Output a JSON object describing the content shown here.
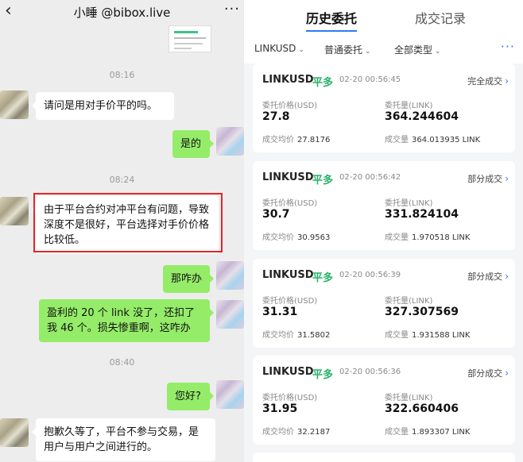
{
  "chat": {
    "back_icon": "back-arrow-icon",
    "title": "小睡 @bibox.live",
    "more_icon": "more-dots-icon",
    "timestamps": [
      "08:16",
      "08:24",
      "08:40"
    ],
    "messages": [
      {
        "side": "in",
        "text": "请问是用对手价平的吗。"
      },
      {
        "side": "out",
        "text": "是的"
      },
      {
        "side": "in",
        "text": "由于平台合约对冲平台有问题，导致深度不是很好，平台选择对手价价格比较低。"
      },
      {
        "side": "out",
        "text": "那咋办"
      },
      {
        "side": "out",
        "text": "盈利的 20 个 link 没了，还扣了我 46 个。损失惨重啊，这咋办"
      },
      {
        "side": "out",
        "text": "您好?"
      },
      {
        "side": "in",
        "text": "抱歉久等了，平台不参与交易，是用户与用户之间进行的。"
      }
    ]
  },
  "trade": {
    "tabs": [
      {
        "label": "历史委托",
        "active": true
      },
      {
        "label": "成交记录",
        "active": false
      }
    ],
    "filters": {
      "pair": "LINKUSD",
      "order_type": "普通委托",
      "all_types": "全部类型"
    },
    "accent_color": "#2b7cf6",
    "buy_color": "#27b36a",
    "labels": {
      "price": "委托价格(USD)",
      "amount": "委托量(LINK)",
      "avg_price": "成交均价",
      "filled": "成交量"
    },
    "orders": [
      {
        "symbol": "LINKUSD",
        "side": "平多",
        "time": "02-20 00:56:45",
        "status": "完全成交",
        "price": "27.8",
        "amount": "364.244604",
        "avg_price": "27.8176",
        "filled": "364.013935 LINK"
      },
      {
        "symbol": "LINKUSD",
        "side": "平多",
        "time": "02-20 00:56:42",
        "status": "部分成交",
        "price": "30.7",
        "amount": "331.824104",
        "avg_price": "30.9563",
        "filled": "1.970518 LINK"
      },
      {
        "symbol": "LINKUSD",
        "side": "平多",
        "time": "02-20 00:56:39",
        "status": "部分成交",
        "price": "31.31",
        "amount": "327.307569",
        "avg_price": "31.5802",
        "filled": "1.931588 LINK"
      },
      {
        "symbol": "LINKUSD",
        "side": "平多",
        "time": "02-20 00:56:36",
        "status": "部分成交",
        "price": "31.95",
        "amount": "322.660406",
        "avg_price": "32.2187",
        "filled": "1.893307 LINK"
      }
    ]
  }
}
